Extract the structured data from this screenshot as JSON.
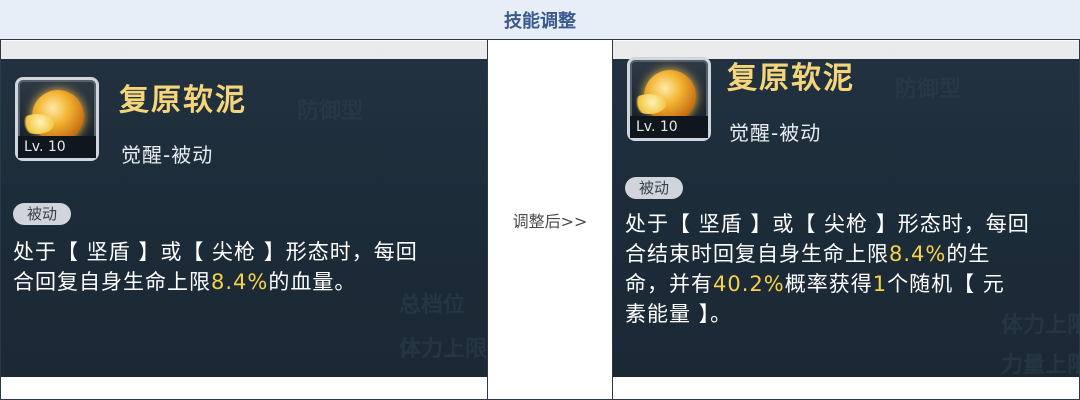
{
  "header": {
    "title": "技能调整"
  },
  "middle": {
    "label": "调整后>>"
  },
  "before": {
    "skill_name": "复原软泥",
    "level": "Lv. 10",
    "type": "觉醒-被动",
    "tag": "被动",
    "desc": {
      "l1": "处于【 坚盾 】或【 尖枪 】形态时，每回",
      "l2a": "合回复自身生命上限",
      "l2b": "8.4%",
      "l2c": "的血量。"
    },
    "bg": [
      "防御型",
      "总档位",
      "体力上限"
    ]
  },
  "after": {
    "skill_name": "复原软泥",
    "level": "Lv. 10",
    "type": "觉醒-被动",
    "tag": "被动",
    "desc": {
      "l1": "处于【 坚盾 】或【 尖枪 】形态时，每回",
      "l2a": "合结束时回复自身生命上限",
      "l2b": "8.4%",
      "l2c": "的生",
      "l3a": "命，并有",
      "l3b": "40.2%",
      "l3c": "概率获得",
      "l3d": "1",
      "l3e": "个随机【 元",
      "l4": "素能量 】。"
    },
    "bg": [
      "防御型",
      "体力上限",
      "力量上限"
    ]
  },
  "colors": {
    "highlight": "#f5d24a",
    "title": "#f4d57a",
    "header_text": "#3b5a8e"
  }
}
